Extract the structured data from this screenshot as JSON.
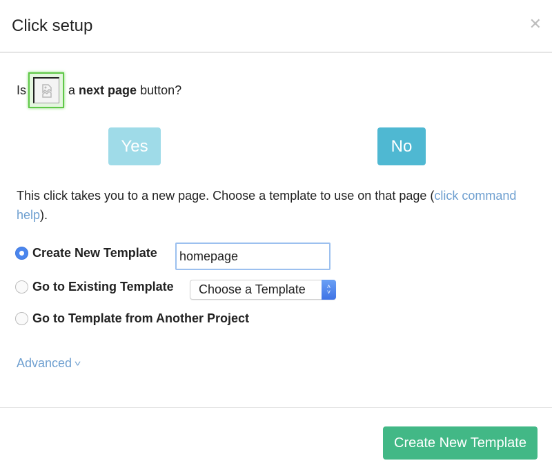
{
  "dialog": {
    "title": "Click setup",
    "close_icon": "close-icon"
  },
  "question": {
    "prefix": "Is",
    "element_thumbnail_icon": "broken-image-icon",
    "middle": "a",
    "emphasis": "next page",
    "suffix": "button?"
  },
  "answers": {
    "yes_label": "Yes",
    "no_label": "No"
  },
  "description": {
    "text": "This click takes you to a new page. Choose a template to use on that page (",
    "link_text": "click command help",
    "suffix": ")."
  },
  "options": [
    {
      "label": "Create New Template",
      "selected": true,
      "input_value": "homepage"
    },
    {
      "label": "Go to Existing Template",
      "selected": false,
      "select_value": "Choose a Template"
    },
    {
      "label": "Go to Template from Another Project",
      "selected": false
    }
  ],
  "advanced": {
    "label": "Advanced",
    "icon": "chevron-down-icon"
  },
  "footer": {
    "primary_label": "Create New Template"
  },
  "colors": {
    "yes": "#9fdbe8",
    "no": "#4fb8d2",
    "primary": "#42b886",
    "link": "#6e9fd0",
    "highlight": "#5fc847"
  }
}
